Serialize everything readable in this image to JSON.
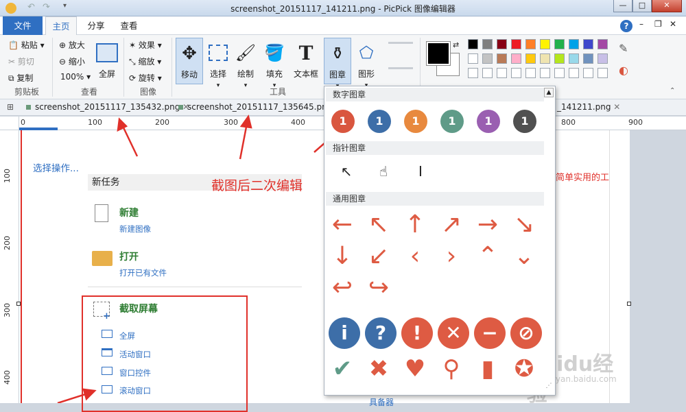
{
  "window": {
    "title": "screenshot_20151117_141211.png - PicPick 图像编辑器"
  },
  "menu": {
    "file": "文件",
    "home": "主页",
    "share": "分享",
    "view": "查看"
  },
  "ribbon": {
    "paste": "粘贴",
    "cut": "剪切",
    "copy": "复制",
    "clipboard_group": "剪贴板",
    "zoom_in": "放大",
    "zoom_out": "缩小",
    "zoom_level": "100%",
    "fullscreen": "全屏",
    "view_group": "查看",
    "effects": "效果",
    "resize": "缩放",
    "rotate": "旋转",
    "image_group": "图像",
    "move": "移动",
    "select": "选择",
    "draw": "绘制",
    "fill": "填充",
    "textbox": "文本框",
    "stamp": "图章",
    "shape": "图形",
    "tools_group": "工具"
  },
  "colors": {
    "primary": "#000000",
    "secondary": "#ffffff",
    "palette": [
      "#000000",
      "#7f7f7f",
      "#880015",
      "#ed1c24",
      "#ff7f27",
      "#fff200",
      "#22b14c",
      "#00a2e8",
      "#3f48cc",
      "#a349a4",
      "#ffffff",
      "#c3c3c3",
      "#b97a57",
      "#ffaec9",
      "#ffc90e",
      "#efe4b0",
      "#b5e61d",
      "#99d9ea",
      "#7092be",
      "#c8bfe7",
      "#ffffff",
      "#ffffff",
      "#ffffff",
      "#ffffff",
      "#ffffff",
      "#ffffff",
      "#ffffff",
      "#ffffff",
      "#ffffff",
      "#ffffff"
    ]
  },
  "tabs": [
    "screenshot_20151117_135432.png",
    "screenshot_20151117_135645.png",
    "_141211.png"
  ],
  "ruler": {
    "h": [
      "0",
      "100",
      "200",
      "300",
      "400",
      "800",
      "900"
    ],
    "v": [
      "100",
      "200",
      "300",
      "400"
    ]
  },
  "canvas": {
    "select_action": "选择操作...",
    "new_task": "新任务",
    "new_title": "新建",
    "new_sub": "新建图像",
    "open_title": "打开",
    "open_sub": "打开已有文件",
    "capture_title": "截取屏幕",
    "capture_items": [
      "全屏",
      "活动窗口",
      "窗口控件",
      "滚动窗口"
    ],
    "annotation_main": "截图后二次编辑",
    "annotation_right": "简单实用的工",
    "bottom_partial": "具备器"
  },
  "stamp_panel": {
    "section_number": "数字图章",
    "number_value": "1",
    "number_colors": [
      "#d9563f",
      "#3d6ea8",
      "#e8893e",
      "#5f9b88",
      "#9a5fb1",
      "#505050"
    ],
    "section_pointer": "指针图章",
    "section_common": "通用图章",
    "pointer_glyphs": [
      "↖",
      "☝",
      "Ⅰ"
    ],
    "arrow_glyphs": [
      "←",
      "↖",
      "↑",
      "↗",
      "→",
      "↘",
      "↓",
      "↙",
      "‹",
      "›",
      "⌃",
      "⌄",
      "↩",
      "↪"
    ],
    "symbol_glyphs": [
      "i",
      "?",
      "!",
      "✕",
      "−",
      "⊘"
    ],
    "last_glyphs": [
      "✔",
      "✖",
      "♥",
      "⚲",
      "▮",
      "✪"
    ]
  },
  "watermark": {
    "text": "Baidu经验",
    "sub": "jingyan.baidu.com"
  }
}
